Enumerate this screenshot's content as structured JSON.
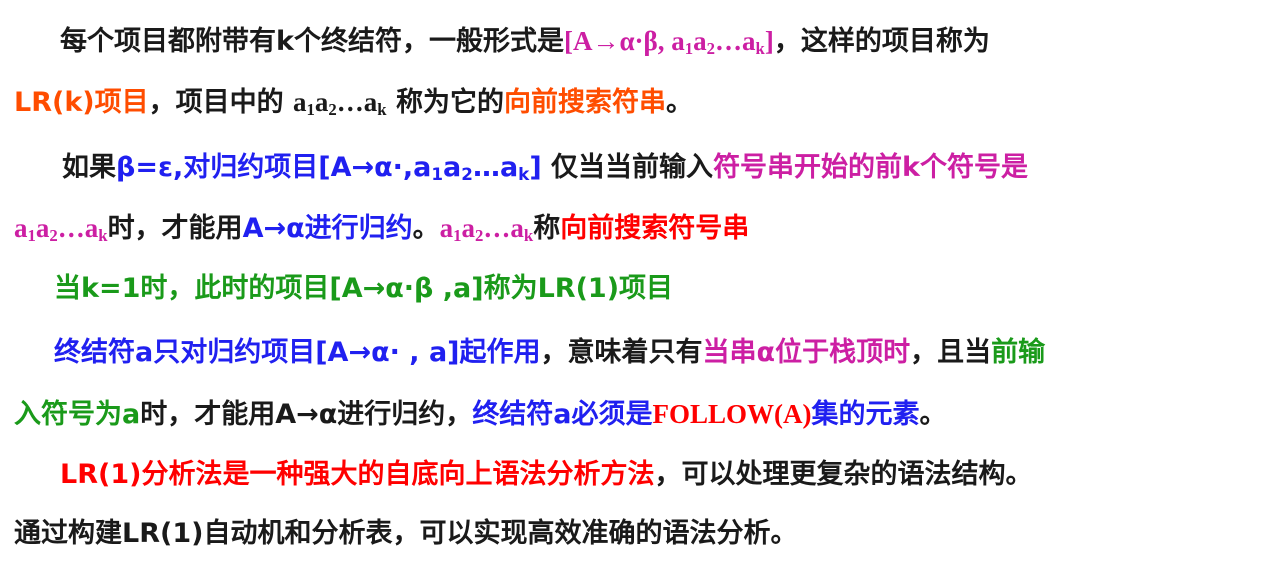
{
  "colors": {
    "black": "#1a1a1a",
    "red": "#ff0000",
    "magenta": "#cc1fa3",
    "blue": "#2020f0",
    "green": "#1a9a1a",
    "orange": "#ff4d00"
  },
  "l1": {
    "t1": "每个项目都附带有k个终结符，一般形式是",
    "item_a": "[A→α·β, a",
    "s1": "1",
    "a2": "a",
    "s2": "2",
    "dots": "…a",
    "sk": "k",
    "close": "]",
    "t2": "，这样的项目称为"
  },
  "l2": {
    "lrk": "LR(k)项目",
    "t1": "，项目中的 ",
    "a1": "a",
    "s1": "1",
    "a2": "a",
    "s2": "2",
    "dots": "…a",
    "sk": "k",
    "t2": " 称为它的",
    "hl": "向前搜索符串",
    "end": "。"
  },
  "l3": {
    "t1": "如果",
    "beta": "β=ε,对归约项目[A→α·,a",
    "s1": "1",
    "a2": "a",
    "s2": "2",
    "dots": "…a",
    "sk": "k",
    "close": "]",
    "t2": " 仅当当前输入",
    "hl": "符号串开始的前k个符号是"
  },
  "l4": {
    "a1": "a",
    "s1": "1",
    "a2": "a",
    "s2": "2",
    "dots": "…a",
    "sk": "k",
    "t1": "时，才能用",
    "red": "A→α进行归约",
    "t2": "。",
    "b1": "a",
    "bs1": "1",
    "b2": "a",
    "bs2": "2",
    "bdots": "…a",
    "bsk": "k",
    "t3": "称",
    "hl": "向前搜索符号串"
  },
  "l5": {
    "text": "当k=1时，此时的项目[A→α·β ,a]称为LR(1)项目"
  },
  "l6": {
    "blue": "终结符a只对归约项目[A→α· , a]起作用",
    "t1": "，意味着只有",
    "mag": "当串α位于栈顶时",
    "t2": "，且当",
    "green": "前输"
  },
  "l7": {
    "green": "入符号为a",
    "t1": "时，才能用A→α进行归约，",
    "blue1": "终结符a必须是",
    "red": "FOLLOW(A)",
    "blue2": "集的元素",
    "end": "。"
  },
  "l8": {
    "red": "LR(1)分析法是一种强大的自底向上语法分析方法",
    "t1": "，可以处理更复杂的语法结构。"
  },
  "l9": {
    "text": "通过构建LR(1)自动机和分析表，可以实现高效准确的语法分析。"
  }
}
